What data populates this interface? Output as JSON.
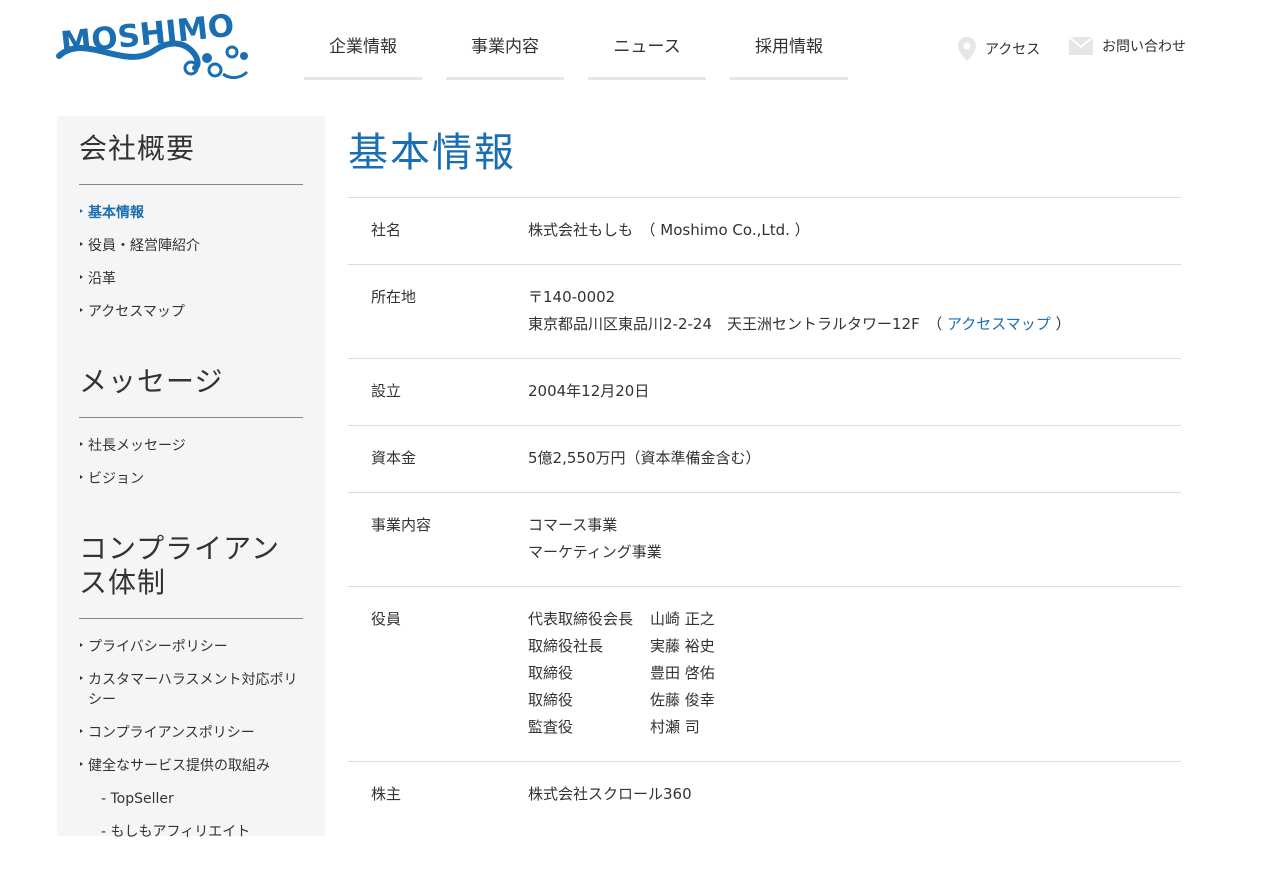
{
  "logo": {
    "text": "MOSHIMO"
  },
  "nav": {
    "items": [
      {
        "label": "企業情報"
      },
      {
        "label": "事業内容"
      },
      {
        "label": "ニュース"
      },
      {
        "label": "採用情報"
      }
    ],
    "access_label": "アクセス",
    "contact_label": "お問い合わせ"
  },
  "sidebar": {
    "sections": [
      {
        "heading": "会社概要",
        "items": [
          "基本情報",
          "役員・経営陣紹介",
          "沿革",
          "アクセスマップ"
        ]
      },
      {
        "heading": "メッセージ",
        "items": [
          "社長メッセージ",
          "ビジョン"
        ]
      },
      {
        "heading_line1": "コンプライアン",
        "heading_line2": "ス体制",
        "items": [
          "プライバシーポリシー",
          "カスタマーハラスメント対応ポリシー",
          "コンプライアンスポリシー",
          "健全なサービス提供の取組み"
        ],
        "sub_items": [
          "- TopSeller",
          "- もしもアフィリエイト"
        ]
      }
    ]
  },
  "main": {
    "title": "基本情報",
    "rows": {
      "company": {
        "label": "社名",
        "value": "株式会社もしも　（ Moshimo Co.,Ltd. ）"
      },
      "address": {
        "label": "所在地",
        "postal": "〒140-0002",
        "line": "東京都品川区東品川2-2-24　天王洲セントラルタワー12F　（",
        "link": "アクセスマップ",
        "close": "）"
      },
      "founded": {
        "label": "設立",
        "value": "2004年12月20日"
      },
      "capital": {
        "label": "資本金",
        "value": "5億2,550万円（資本準備金含む）"
      },
      "business": {
        "label": "事業内容",
        "line1": "コマース事業",
        "line2": "マーケティング事業"
      },
      "officers": {
        "label": "役員",
        "list": [
          {
            "title": "代表取締役会長",
            "name": "山崎 正之"
          },
          {
            "title": "取締役社長",
            "name": "実藤 裕史"
          },
          {
            "title": "取締役",
            "name": "豊田 啓佑"
          },
          {
            "title": "取締役",
            "name": "佐藤 俊幸"
          },
          {
            "title": "監査役",
            "name": "村瀬 司"
          }
        ]
      },
      "shareholder": {
        "label": "株主",
        "value": "株式会社スクロール360"
      }
    }
  },
  "colors": {
    "accent": "#1a6fb3",
    "sidebar_bg": "#f5f5f5",
    "divider": "#dcdcdc"
  }
}
